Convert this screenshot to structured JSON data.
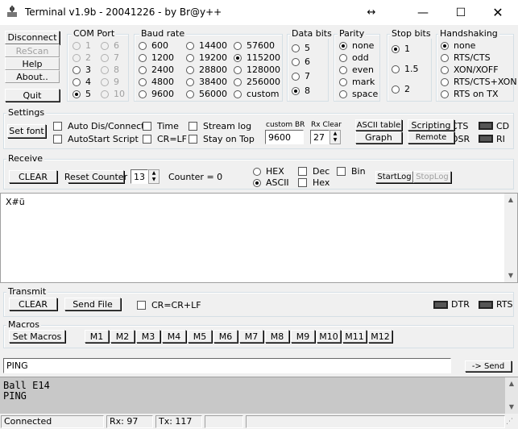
{
  "window": {
    "title": "Terminal v1.9b - 20041226 - by Br@y++"
  },
  "buttons": {
    "disconnect": "Disconnect",
    "rescan": "ReScan",
    "help": "Help",
    "about": "About..",
    "quit": "Quit",
    "set_font": "Set font",
    "ascii_table": "ASCII table",
    "scripting": "Scripting",
    "graph": "Graph",
    "remote": "Remote",
    "clear_receive": "CLEAR",
    "reset_counter": "Reset Counter",
    "startlog": "StartLog",
    "stoplog": "StopLog",
    "clear_transmit": "CLEAR",
    "send_file": "Send File",
    "set_macros": "Set Macros",
    "send": "-> Send"
  },
  "groups": {
    "com_port": "COM Port",
    "baud_rate": "Baud rate",
    "data_bits": "Data bits",
    "parity": "Parity",
    "stop_bits": "Stop bits",
    "handshaking": "Handshaking",
    "settings": "Settings",
    "receive": "Receive",
    "transmit": "Transmit",
    "macros": "Macros"
  },
  "com_ports": [
    "1",
    "2",
    "3",
    "4",
    "5",
    "6",
    "7",
    "8",
    "9",
    "10"
  ],
  "baud_rates": [
    "600",
    "1200",
    "2400",
    "4800",
    "9600",
    "14400",
    "19200",
    "28800",
    "38400",
    "56000",
    "57600",
    "115200",
    "128000",
    "256000",
    "custom"
  ],
  "data_bits": [
    "5",
    "6",
    "7",
    "8"
  ],
  "parity": [
    "none",
    "odd",
    "even",
    "mark",
    "space"
  ],
  "stop_bits": [
    "1",
    "1.5",
    "2"
  ],
  "handshaking": [
    "none",
    "RTS/CTS",
    "XON/XOFF",
    "RTS/CTS+XON",
    "RTS on TX"
  ],
  "settings": {
    "auto_dis": "Auto Dis/Connect",
    "autostart": "AutoStart Script",
    "time": "Time",
    "crlf": "CR=LF",
    "stream_log": "Stream log",
    "stay_on_top": "Stay on Top",
    "custom_br_label": "custom BR",
    "custom_br_value": "9600",
    "rx_clear_label": "Rx Clear",
    "rx_clear_value": "27",
    "cts": "CTS",
    "dsr": "DSR",
    "cd": "CD",
    "ri": "RI"
  },
  "receive": {
    "counter_value": "13",
    "counter_label": "Counter =  0",
    "hex": "HEX",
    "ascii": "ASCII",
    "dec": "Dec",
    "bin": "Bin",
    "hex2": "Hex",
    "content": "X#ü"
  },
  "transmit": {
    "crcrlf": "CR=CR+LF",
    "dtr": "DTR",
    "rts": "RTS"
  },
  "macros": [
    "M1",
    "M2",
    "M3",
    "M4",
    "M5",
    "M6",
    "M7",
    "M8",
    "M9",
    "M10",
    "M11",
    "M12"
  ],
  "input": {
    "value": "PING"
  },
  "log": [
    "Ball E14",
    "PING"
  ],
  "status": {
    "connected": "Connected",
    "rx": "Rx: 97",
    "tx": "Tx: 117"
  }
}
